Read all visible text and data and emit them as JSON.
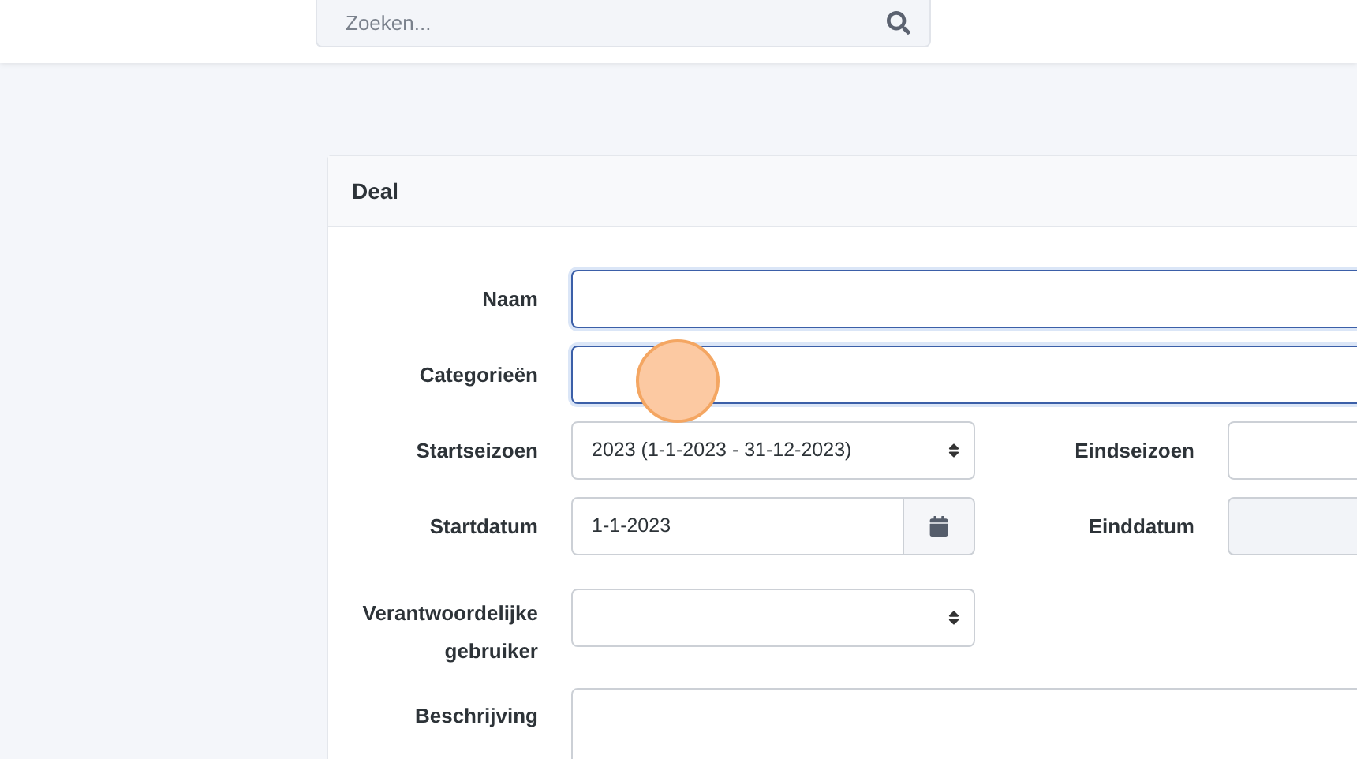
{
  "search": {
    "placeholder": "Zoeken..."
  },
  "card": {
    "title": "Deal",
    "rows": [
      {
        "cells": [
          {
            "label": "Naam",
            "kind": "text",
            "wide": true,
            "focused": true
          }
        ]
      },
      {
        "cells": [
          {
            "label": "Categorieën",
            "kind": "text",
            "wide": true,
            "focused": true
          }
        ]
      },
      {
        "cells": [
          {
            "label": "Startseizoen",
            "kind": "select",
            "value": "2023 (1-1-2023 - 31-12-2023)"
          },
          {
            "label": "Eindseizoen",
            "kind": "text"
          }
        ]
      },
      {
        "cells": [
          {
            "label": "Startdatum",
            "kind": "date",
            "value": "1-1-2023"
          },
          {
            "label": "Einddatum",
            "kind": "text",
            "disabled": true
          }
        ]
      },
      {
        "cells": [
          {
            "label": "Verantwoordelijke gebruiker",
            "kind": "select"
          }
        ]
      },
      {
        "cells": [
          {
            "label": "Beschrijving",
            "kind": "textarea",
            "wide": true
          }
        ]
      }
    ]
  }
}
